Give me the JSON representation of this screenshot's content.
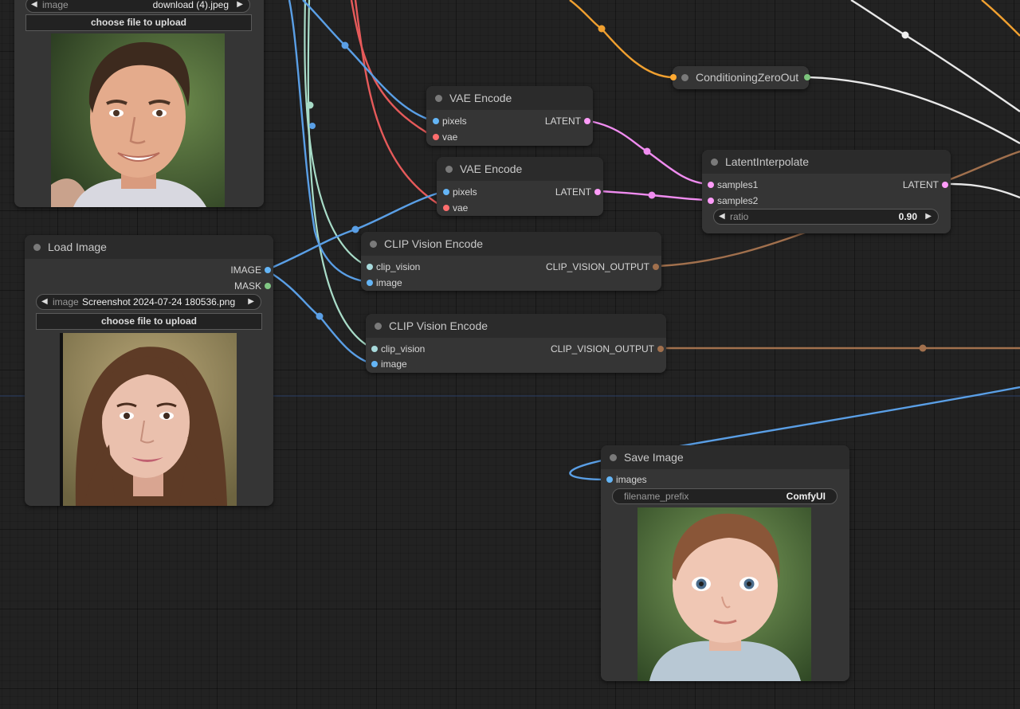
{
  "nodes": {
    "load_image_top": {
      "image_widget": {
        "label": "image",
        "value": "download (4).jpeg"
      },
      "upload_label": "choose file to upload"
    },
    "load_image": {
      "title": "Load Image",
      "outputs": {
        "image": "IMAGE",
        "mask": "MASK"
      },
      "image_widget": {
        "label": "image",
        "value": "Screenshot 2024-07-24 180536.png"
      },
      "upload_label": "choose file to upload"
    },
    "vae_encode_1": {
      "title": "VAE Encode",
      "inputs": {
        "pixels": "pixels",
        "vae": "vae"
      },
      "output": "LATENT"
    },
    "vae_encode_2": {
      "title": "VAE Encode",
      "inputs": {
        "pixels": "pixels",
        "vae": "vae"
      },
      "output": "LATENT"
    },
    "conditioning_zero_out": {
      "title": "ConditioningZeroOut"
    },
    "latent_interpolate": {
      "title": "LatentInterpolate",
      "inputs": {
        "samples1": "samples1",
        "samples2": "samples2"
      },
      "output": "LATENT",
      "ratio_widget": {
        "label": "ratio",
        "value": "0.90"
      }
    },
    "clip_vision_encode_1": {
      "title": "CLIP Vision Encode",
      "inputs": {
        "clip_vision": "clip_vision",
        "image": "image"
      },
      "output": "CLIP_VISION_OUTPUT"
    },
    "clip_vision_encode_2": {
      "title": "CLIP Vision Encode",
      "inputs": {
        "clip_vision": "clip_vision",
        "image": "image"
      },
      "output": "CLIP_VISION_OUTPUT"
    },
    "save_image": {
      "title": "Save Image",
      "inputs": {
        "images": "images"
      },
      "prefix_widget": {
        "label": "filename_prefix",
        "value": "ComfyUI"
      }
    }
  },
  "colors": {
    "background": "#222222",
    "node_body": "#353535",
    "node_header": "#2b2b2b",
    "image_link": "#64b5f6",
    "vae_link": "#ff6e6e",
    "latent_link": "#ff9cf9",
    "clip_vision_link": "#a8dadc",
    "clip_vision_output_link": "#a1704d",
    "conditioning_link": "#ffa931",
    "mask_link": "#81c784"
  },
  "icons": {
    "arrow_left": "◀",
    "arrow_right": "▶"
  }
}
